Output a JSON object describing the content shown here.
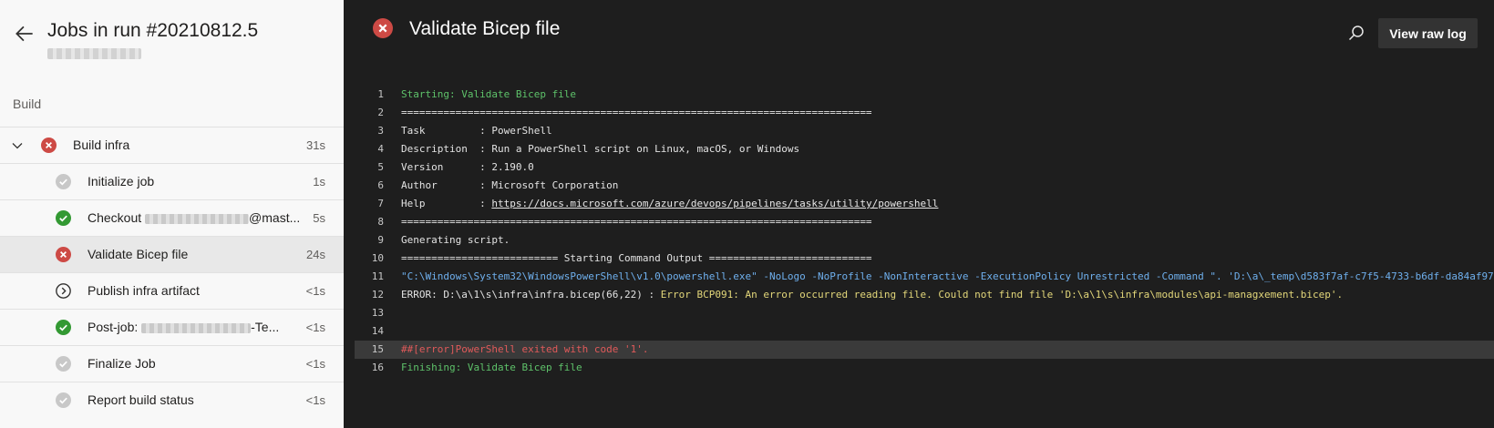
{
  "sidebar": {
    "title": "Jobs in run #20210812.5",
    "section_label": "Build",
    "parent_job": {
      "label": "Build infra",
      "duration": "31s",
      "status": "failed"
    },
    "steps": [
      {
        "label": "Initialize job",
        "duration": "1s",
        "status": "success-gray"
      },
      {
        "label_prefix": "Checkout ",
        "label_suffix": "@mast...",
        "duration": "5s",
        "status": "success"
      },
      {
        "label": "Validate Bicep file",
        "duration": "24s",
        "status": "failed"
      },
      {
        "label": "Publish infra artifact",
        "duration": "<1s",
        "status": "skipped"
      },
      {
        "label_prefix": "Post-job: ",
        "label_suffix": "-Te...",
        "duration": "<1s",
        "status": "success"
      },
      {
        "label": "Finalize Job",
        "duration": "<1s",
        "status": "success-gray"
      },
      {
        "label": "Report build status",
        "duration": "<1s",
        "status": "success-gray"
      }
    ]
  },
  "main": {
    "title": "Validate Bicep file",
    "view_raw_label": "View raw log",
    "log": [
      {
        "n": "1",
        "text": "Starting: Validate Bicep file"
      },
      {
        "n": "2",
        "text": "=============================================================================="
      },
      {
        "n": "3",
        "text": "Task         : PowerShell"
      },
      {
        "n": "4",
        "text": "Description  : Run a PowerShell script on Linux, macOS, or Windows"
      },
      {
        "n": "5",
        "text": "Version      : 2.190.0"
      },
      {
        "n": "6",
        "text": "Author       : Microsoft Corporation"
      },
      {
        "n": "7",
        "text_prefix": "Help         : ",
        "link": "https://docs.microsoft.com/azure/devops/pipelines/tasks/utility/powershell"
      },
      {
        "n": "8",
        "text": "=============================================================================="
      },
      {
        "n": "9",
        "text": "Generating script."
      },
      {
        "n": "10",
        "text": "========================== Starting Command Output ==========================="
      },
      {
        "n": "11",
        "text": "\"C:\\Windows\\System32\\WindowsPowerShell\\v1.0\\powershell.exe\" -NoLogo -NoProfile -NonInteractive -ExecutionPolicy Unrestricted -Command \". 'D:\\a\\_temp\\d583f7af-c7f5-4733-b6df-da84af97"
      },
      {
        "n": "12",
        "text_prefix": "ERROR: D:\\a\\1\\s\\infra\\infra.bicep(66,22) : ",
        "text_error": "Error BCP091: An error occurred reading file. Could not find file 'D:\\a\\1\\s\\infra\\modules\\api-managxement.bicep'."
      },
      {
        "n": "13",
        "text": ""
      },
      {
        "n": "14",
        "text": ""
      },
      {
        "n": "15",
        "text": "##[error]PowerShell exited with code '1'."
      },
      {
        "n": "16",
        "text": "Finishing: Validate Bicep file"
      }
    ]
  },
  "colors": {
    "success": "#339933",
    "failed": "#cd4a45",
    "neutral": "#c8c8c8",
    "log_green": "#5ec26a",
    "log_blue": "#6fb0ee",
    "log_yellow": "#e3d77a",
    "log_red": "#e05a5a"
  }
}
